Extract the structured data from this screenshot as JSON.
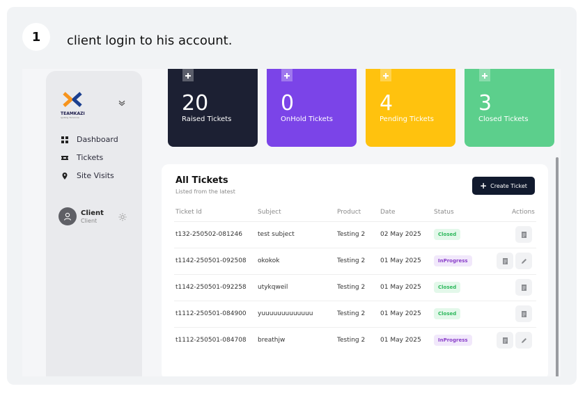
{
  "step": {
    "number": "1",
    "text": "client login to his account."
  },
  "brand": {
    "name": "TEAMKAZI",
    "tagline": "Igniting Tomorrow"
  },
  "sidebar": {
    "items": [
      {
        "label": "Dashboard",
        "icon": "grid-icon"
      },
      {
        "label": "Tickets",
        "icon": "ticket-icon"
      },
      {
        "label": "Site Visits",
        "icon": "location-pin-icon"
      }
    ],
    "user": {
      "name": "Client",
      "role": "Client"
    }
  },
  "cards": [
    {
      "number": "20",
      "label": "Raised Tickets",
      "color": "#1c2033"
    },
    {
      "number": "0",
      "label": "OnHold Tickets",
      "color": "#7b44e8"
    },
    {
      "number": "4",
      "label": "Pending Tickets",
      "color": "#ffc20e"
    },
    {
      "number": "3",
      "label": "Closed Tickets",
      "color": "#5ccf8c"
    }
  ],
  "tickets": {
    "title": "All Tickets",
    "subtitle": "Listed from the latest",
    "create_label": "Create Ticket",
    "columns": [
      "Ticket Id",
      "Subject",
      "Product",
      "Date",
      "Status",
      "Actions"
    ],
    "rows": [
      {
        "id": "t132-250502-081246",
        "subject": "test subject",
        "product": "Testing 2",
        "date": "02 May 2025",
        "status": "Closed"
      },
      {
        "id": "t1142-250501-092508",
        "subject": "okokok",
        "product": "Testing 2",
        "date": "01 May 2025",
        "status": "InProgress"
      },
      {
        "id": "t1142-250501-092258",
        "subject": "utykqweil",
        "product": "Testing 2",
        "date": "01 May 2025",
        "status": "Closed"
      },
      {
        "id": "t1112-250501-084900",
        "subject": "yuuuuuuuuuuuuu",
        "product": "Testing 2",
        "date": "01 May 2025",
        "status": "Closed"
      },
      {
        "id": "t1112-250501-084708",
        "subject": "breathjw",
        "product": "Testing 2",
        "date": "01 May 2025",
        "status": "InProgress"
      }
    ]
  }
}
